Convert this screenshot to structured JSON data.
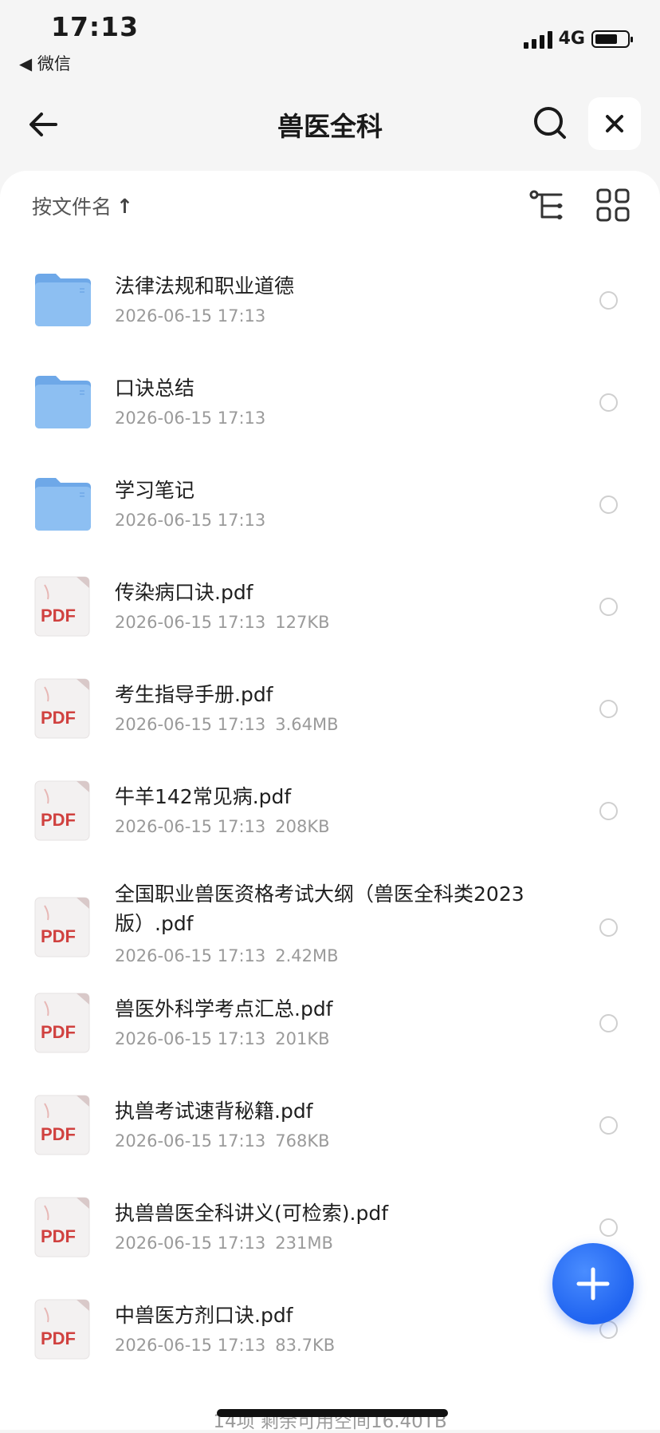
{
  "status_bar": {
    "time": "17:13",
    "back_app": "◀ 微信",
    "network": "4G",
    "battery_level": 0.62
  },
  "header": {
    "title": "兽医全科"
  },
  "toolbar": {
    "sort_label": "按文件名",
    "sort_arrow": "↑"
  },
  "files": [
    {
      "type": "folder",
      "name": "法律法规和职业道德",
      "date": "2026-06-15 17:13",
      "size": ""
    },
    {
      "type": "folder",
      "name": "口诀总结",
      "date": "2026-06-15 17:13",
      "size": ""
    },
    {
      "type": "folder",
      "name": "学习笔记",
      "date": "2026-06-15 17:13",
      "size": ""
    },
    {
      "type": "pdf",
      "name": "传染病口诀.pdf",
      "date": "2026-06-15 17:13",
      "size": "127KB"
    },
    {
      "type": "pdf",
      "name": "考生指导手册.pdf",
      "date": "2026-06-15 17:13",
      "size": "3.64MB"
    },
    {
      "type": "pdf",
      "name": "牛羊142常见病.pdf",
      "date": "2026-06-15 17:13",
      "size": "208KB"
    },
    {
      "type": "pdf",
      "name": "全国职业兽医资格考试大纲（兽医全科类2023版）.pdf",
      "date": "2026-06-15 17:13",
      "size": "2.42MB"
    },
    {
      "type": "pdf",
      "name": "兽医外科学考点汇总.pdf",
      "date": "2026-06-15 17:13",
      "size": "201KB"
    },
    {
      "type": "pdf",
      "name": "执兽考试速背秘籍.pdf",
      "date": "2026-06-15 17:13",
      "size": "768KB"
    },
    {
      "type": "pdf",
      "name": "执兽兽医全科讲义(可检索).pdf",
      "date": "2026-06-15 17:13",
      "size": "231MB"
    },
    {
      "type": "pdf",
      "name": "中兽医方剂口诀.pdf",
      "date": "2026-06-15 17:13",
      "size": "83.7KB"
    }
  ],
  "pdf_badge": "PDF",
  "footer": {
    "summary": "14项 剩余可用空间16.40TB"
  },
  "colors": {
    "accent": "#1f63f0",
    "folder": "#8dbff2",
    "pdf_red": "#d0413f"
  }
}
